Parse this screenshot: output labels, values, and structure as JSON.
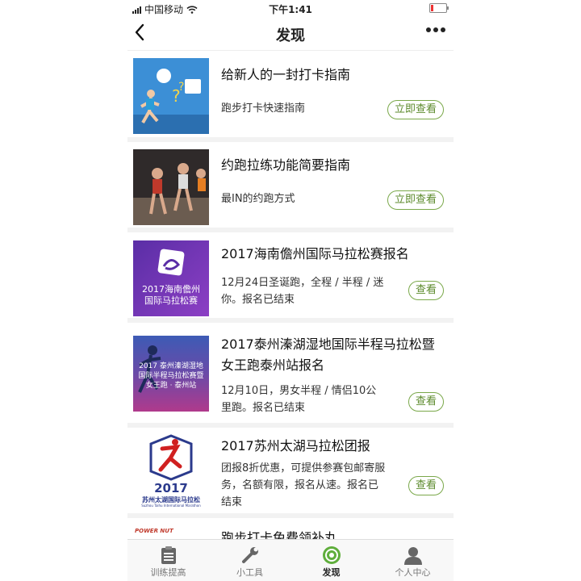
{
  "status": {
    "carrier": "中国移动",
    "time": "下午1:41"
  },
  "nav": {
    "title": "发现"
  },
  "items": [
    {
      "title": "给新人的一封打卡指南",
      "desc": "跑步打卡快速指南",
      "button": "立即查看"
    },
    {
      "title": "约跑拉练功能简要指南",
      "desc": "最IN的约跑方式",
      "button": "立即查看"
    },
    {
      "title": "2017海南儋州国际马拉松赛报名",
      "desc": "12月24日圣诞跑，全程 / 半程 / 迷你。报名已结束",
      "button": "查看",
      "thumb_text": [
        "2017海南儋州",
        "国际马拉松赛"
      ]
    },
    {
      "title": "2017泰州溱湖湿地国际半程马拉松暨女王跑泰州站报名",
      "desc": "12月10日，男女半程 / 情侣10公里跑。报名已结束",
      "button": "查看",
      "thumb_text": [
        "2017 泰州溱湖湿地",
        "国际半程马拉松赛暨",
        "女王跑 · 泰州站"
      ]
    },
    {
      "title": "2017苏州太湖马拉松团报",
      "desc": "团报8折优惠，可提供参赛包邮寄服务，名额有限，报名从速。报名已结束",
      "button": "查看",
      "thumb_text": [
        "2017",
        "苏州太湖国际马拉松",
        "Suzhou Taihu International Marathon"
      ]
    },
    {
      "title": "跑步打卡免费领补丸",
      "thumb_text": [
        "POWER NUT"
      ]
    }
  ],
  "tabs": [
    {
      "label": "训练提高",
      "icon": "clipboard-icon"
    },
    {
      "label": "小工具",
      "icon": "wrench-icon"
    },
    {
      "label": "发现",
      "icon": "discover-icon",
      "active": true
    },
    {
      "label": "个人中心",
      "icon": "person-icon"
    }
  ],
  "colors": {
    "accent": "#5c8a2c",
    "battery_low": "#ee3333"
  }
}
